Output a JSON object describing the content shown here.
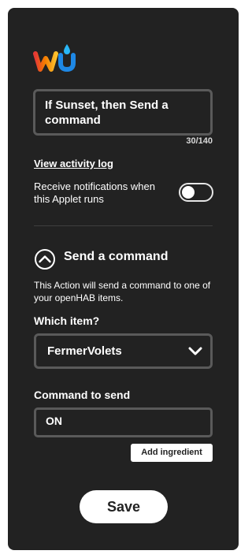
{
  "brand": {
    "logo_icon": "weather-underground-logo"
  },
  "applet": {
    "title": "If Sunset, then Send a command",
    "char_count": "30/140"
  },
  "links": {
    "activity_log": "View activity log"
  },
  "notifications": {
    "label": "Receive notifications when this Applet runs",
    "enabled": false
  },
  "action": {
    "title": "Send a command",
    "description": "This Action will send a command to one of your openHAB items."
  },
  "item_field": {
    "label": "Which item?",
    "selected": "FermerVolets"
  },
  "command_field": {
    "label": "Command to send",
    "value": "ON"
  },
  "buttons": {
    "add_ingredient": "Add ingredient",
    "save": "Save"
  },
  "colors": {
    "panel": "#222222",
    "field_border": "#5a5a5a",
    "text": "#ffffff"
  }
}
